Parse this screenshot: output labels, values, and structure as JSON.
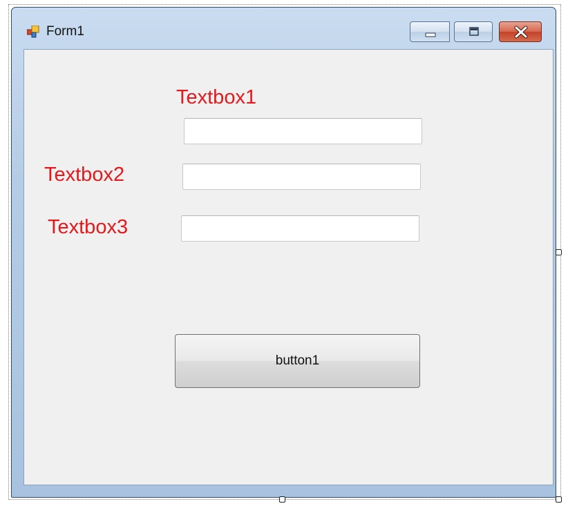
{
  "window": {
    "title": "Form1",
    "icon": "form-icon",
    "caption_buttons": [
      "minimize-icon",
      "maximize-icon",
      "close-icon"
    ]
  },
  "form": {
    "labels": {
      "textbox1": "Textbox1",
      "textbox2": "Textbox2",
      "textbox3": "Textbox3"
    },
    "textboxes": {
      "textbox1_value": "",
      "textbox2_value": "",
      "textbox3_value": ""
    },
    "button1_label": "button1"
  },
  "colors": {
    "label_color": "#e3191c",
    "client_background": "#f0f0f0",
    "titlebar": "#b5cce6"
  }
}
